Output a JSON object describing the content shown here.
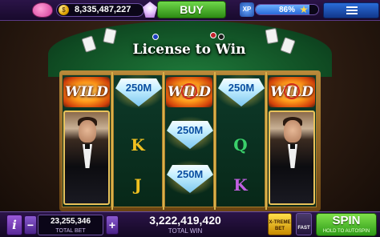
{
  "header": {
    "coins": "8,335,487,227",
    "buy_label": "BUY",
    "xp_label": "XP",
    "xp_percent_text": "86%",
    "xp_progress": 0.86
  },
  "game": {
    "title": "License to Win",
    "wild_label": "WILD",
    "diamond_value": "250M",
    "symbols": {
      "k": "K",
      "q": "Q",
      "j": "J"
    }
  },
  "footer": {
    "info_label": "i",
    "minus_label": "−",
    "plus_label": "+",
    "total_bet_value": "23,255,346",
    "total_bet_label": "TOTAL BET",
    "total_win_value": "3,222,419,420",
    "total_win_label": "TOTAL WIN",
    "xtreme_label": "X-TREME BET",
    "fast_label": "FAST",
    "spin_label": "SPIN",
    "spin_hint": "HOLD TO AUTOSPIN"
  },
  "colors": {
    "accent_green": "#3fb31f",
    "bar_purple": "#2b1448",
    "gold": "#e9c25a"
  }
}
